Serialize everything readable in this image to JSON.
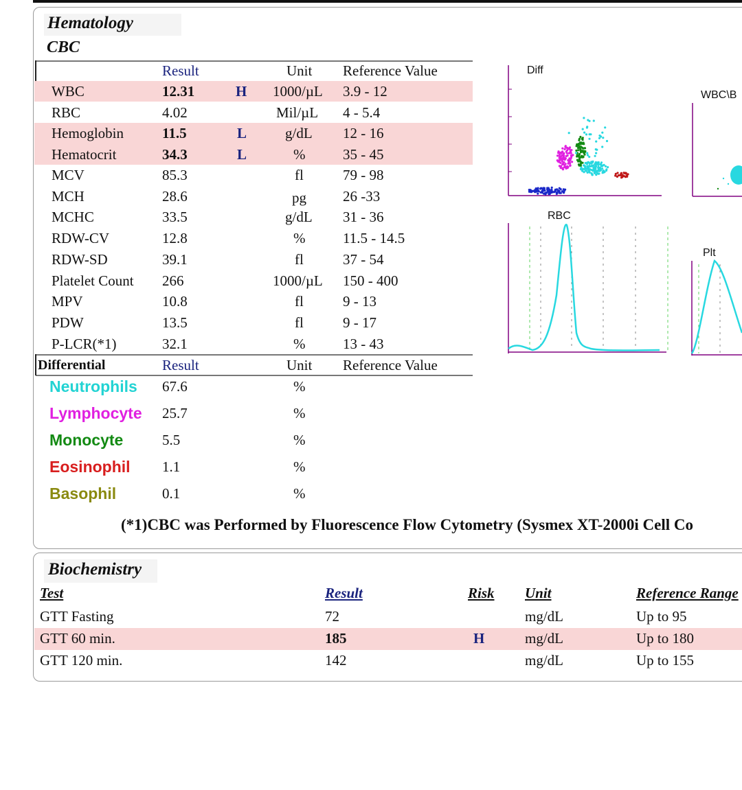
{
  "hematology": {
    "title": "Hematology",
    "subtitle": "CBC",
    "headers": {
      "result": "Result",
      "unit": "Unit",
      "reference": "Reference Value"
    },
    "rows": [
      {
        "name": "WBC",
        "result": "12.31",
        "flag": "H",
        "unit": "1000/µL",
        "ref": "3.9 - 12"
      },
      {
        "name": "RBC",
        "result": "4.02",
        "flag": "",
        "unit": "Mil/µL",
        "ref": "4 - 5.4"
      },
      {
        "name": "Hemoglobin",
        "result": "11.5",
        "flag": "L",
        "unit": "g/dL",
        "ref": "12 - 16"
      },
      {
        "name": "Hematocrit",
        "result": "34.3",
        "flag": "L",
        "unit": "%",
        "ref": "35 - 45"
      },
      {
        "name": "MCV",
        "result": "85.3",
        "flag": "",
        "unit": "fl",
        "ref": "79 - 98"
      },
      {
        "name": "MCH",
        "result": "28.6",
        "flag": "",
        "unit": "pg",
        "ref": "26 -33"
      },
      {
        "name": "MCHC",
        "result": "33.5",
        "flag": "",
        "unit": "g/dL",
        "ref": "31 - 36"
      },
      {
        "name": "RDW-CV",
        "result": "12.8",
        "flag": "",
        "unit": "%",
        "ref": "11.5 - 14.5"
      },
      {
        "name": "RDW-SD",
        "result": "39.1",
        "flag": "",
        "unit": "fl",
        "ref": "37 - 54"
      },
      {
        "name": "Platelet Count",
        "result": "266",
        "flag": "",
        "unit": "1000/µL",
        "ref": "150 - 400"
      },
      {
        "name": "MPV",
        "result": "10.8",
        "flag": "",
        "unit": "fl",
        "ref": "9 - 13"
      },
      {
        "name": "PDW",
        "result": "13.5",
        "flag": "",
        "unit": "fl",
        "ref": "9 - 17"
      },
      {
        "name": "P-LCR(*1)",
        "result": "32.1",
        "flag": "",
        "unit": "%",
        "ref": "13 - 43"
      }
    ],
    "differential": {
      "title": "Differential",
      "headers": {
        "result": "Result",
        "unit": "Unit",
        "reference": "Reference Value"
      },
      "rows": [
        {
          "name": "Neutrophils",
          "result": "67.6",
          "unit": "%",
          "color": "#22d3d3"
        },
        {
          "name": "Lymphocyte",
          "result": "25.7",
          "unit": "%",
          "color": "#e020e0"
        },
        {
          "name": "Monocyte",
          "result": "5.5",
          "unit": "%",
          "color": "#138a13"
        },
        {
          "name": "Eosinophil",
          "result": "1.1",
          "unit": "%",
          "color": "#d81e1e"
        },
        {
          "name": "Basophil",
          "result": "0.1",
          "unit": "%",
          "color": "#8a8a10"
        }
      ]
    },
    "graphs": {
      "diff": "Diff",
      "wbc": "WBC\\B",
      "rbc": "RBC",
      "plt": "Plt"
    },
    "footnote": "(*1)CBC was Performed by Fluorescence Flow Cytometry (Sysmex XT-2000i Cell Co"
  },
  "biochemistry": {
    "title": "Biochemistry",
    "headers": {
      "test": "Test",
      "result": "Result",
      "risk": "Risk",
      "unit": "Unit",
      "reference": "Reference Range"
    },
    "rows": [
      {
        "test": "GTT Fasting",
        "result": "72",
        "risk": "",
        "unit": "mg/dL",
        "ref": "Up to 95"
      },
      {
        "test": "GTT 60 min.",
        "result": "185",
        "risk": "H",
        "unit": "mg/dL",
        "ref": "Up to 180"
      },
      {
        "test": "GTT 120 min.",
        "result": "142",
        "risk": "",
        "unit": "mg/dL",
        "ref": "Up to 155"
      }
    ]
  },
  "colors": {
    "highlight": "#f9d6d6",
    "header_text": "#1a237e",
    "flag_text": "#1a237e",
    "trace": "#28d8e0",
    "axis": "#800080"
  }
}
